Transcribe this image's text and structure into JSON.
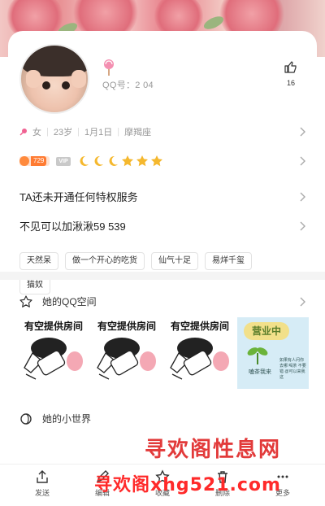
{
  "profile": {
    "qq_label": "QQ号：2        04",
    "like_count": "16"
  },
  "basic_info": {
    "gender": "女",
    "age": "23岁",
    "birthday": "1月1日",
    "zodiac": "摩羯座"
  },
  "badges": {
    "coin_value": "729",
    "vip_label": "VIP",
    "level_icons": [
      "moon-icon",
      "moon-icon",
      "moon-icon",
      "star-icon",
      "star-icon",
      "star-icon"
    ]
  },
  "privilege_text": "TA还未开通任何特权服务",
  "bio_text": "不见可以加湫湫59         539",
  "tags": [
    "天然呆",
    "做一个开心的吃货",
    "仙气十足",
    "易烊千玺",
    "猫奴"
  ],
  "qzone": {
    "title": "她的QQ空间",
    "stickers": [
      "有空提供房间",
      "有空提供房间",
      "有空提供房间"
    ],
    "poster": {
      "title": "营业中",
      "caption": "嗑茶我来",
      "note": "如果有人问你 去哪 喝茶 不要错 @可以来我这"
    }
  },
  "world": {
    "title": "她的小世界"
  },
  "toolbar": {
    "items": [
      {
        "label": "发送",
        "icon": "share-icon"
      },
      {
        "label": "编辑",
        "icon": "edit-icon"
      },
      {
        "label": "收藏",
        "icon": "favorite-icon"
      },
      {
        "label": "删除",
        "icon": "delete-icon"
      },
      {
        "label": "更多",
        "icon": "more-icon"
      }
    ]
  },
  "watermark": {
    "line1": "寻欢阁性息网",
    "line2": "寻欢阁xhg521.com"
  },
  "colors": {
    "accent_orange": "#ff7b32",
    "star_gold": "#f5b82e",
    "watermark_red": "#e23a3a"
  }
}
